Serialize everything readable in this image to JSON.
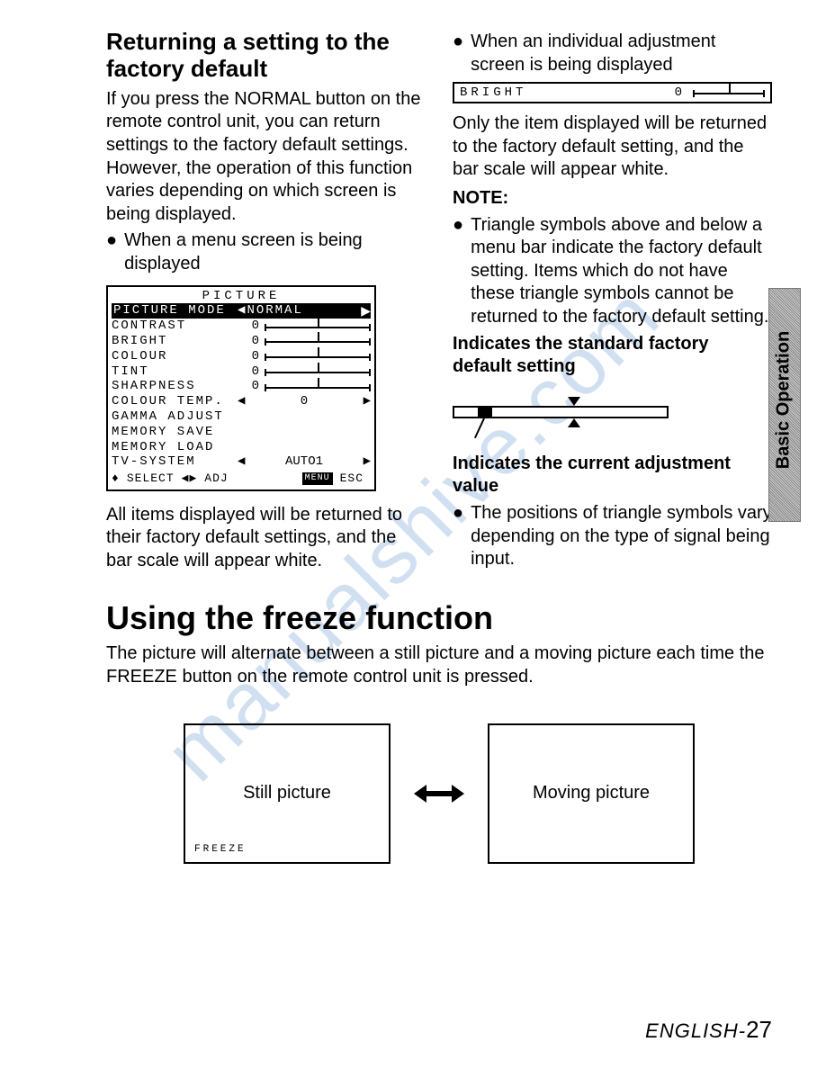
{
  "watermark": "manualshive.com",
  "section1": {
    "heading": "Returning a setting to the factory default",
    "intro": "If you press the NORMAL button on the remote control unit, you can return settings to the factory default settings. However, the operation of this function varies depending on which screen is being displayed.",
    "bullet1": "When a menu screen is being displayed",
    "menu": {
      "title": "PICTURE",
      "highlighted": {
        "label": "PICTURE MODE",
        "value": "NORMAL"
      },
      "rows": [
        {
          "label": "CONTRAST",
          "value": "0",
          "has_bar": true
        },
        {
          "label": "BRIGHT",
          "value": "0",
          "has_bar": true
        },
        {
          "label": "COLOUR",
          "value": "0",
          "has_bar": true
        },
        {
          "label": "TINT",
          "value": "0",
          "has_bar": true
        },
        {
          "label": "SHARPNESS",
          "value": "0",
          "has_bar": true
        },
        {
          "label": "COLOUR TEMP.",
          "value": "0",
          "arrows": true
        },
        {
          "label": "GAMMA ADJUST",
          "value": ""
        },
        {
          "label": "MEMORY SAVE",
          "value": ""
        },
        {
          "label": "MEMORY LOAD",
          "value": ""
        },
        {
          "label": "TV-SYSTEM",
          "value": "AUTO1",
          "arrows": true
        }
      ],
      "footer_select": "SELECT",
      "footer_adj": "ADJ",
      "footer_esc": "ESC"
    },
    "after_menu": "All items displayed will be returned to their factory default settings, and the bar scale will appear white."
  },
  "section1_right": {
    "bullet2": "When an individual adjustment screen is being displayed",
    "bright_box": {
      "label": "BRIGHT",
      "value": "0"
    },
    "after_bright": "Only the item displayed will be returned to the factory default setting, and the bar scale will appear white.",
    "note_label": "NOTE:",
    "note_bullet": "Triangle symbols above and below a menu bar indicate the factory default setting. Items which do not have these triangle symbols cannot be returned to the factory default setting.",
    "ind_default": "Indicates the standard factory default setting",
    "ind_current": "Indicates the current adjustment value",
    "pos_bullet": "The positions of triangle symbols vary depending on the type of signal being input."
  },
  "side_tab": "Basic Operation",
  "section2": {
    "heading": "Using the freeze function",
    "intro": "The picture will alternate between a still picture and a moving picture each time the FREEZE button on the remote control unit is pressed.",
    "left_box": "Still picture",
    "left_tag": "FREEZE",
    "right_box": "Moving picture"
  },
  "footer": {
    "lang": "ENGLISH-",
    "page": "27"
  }
}
